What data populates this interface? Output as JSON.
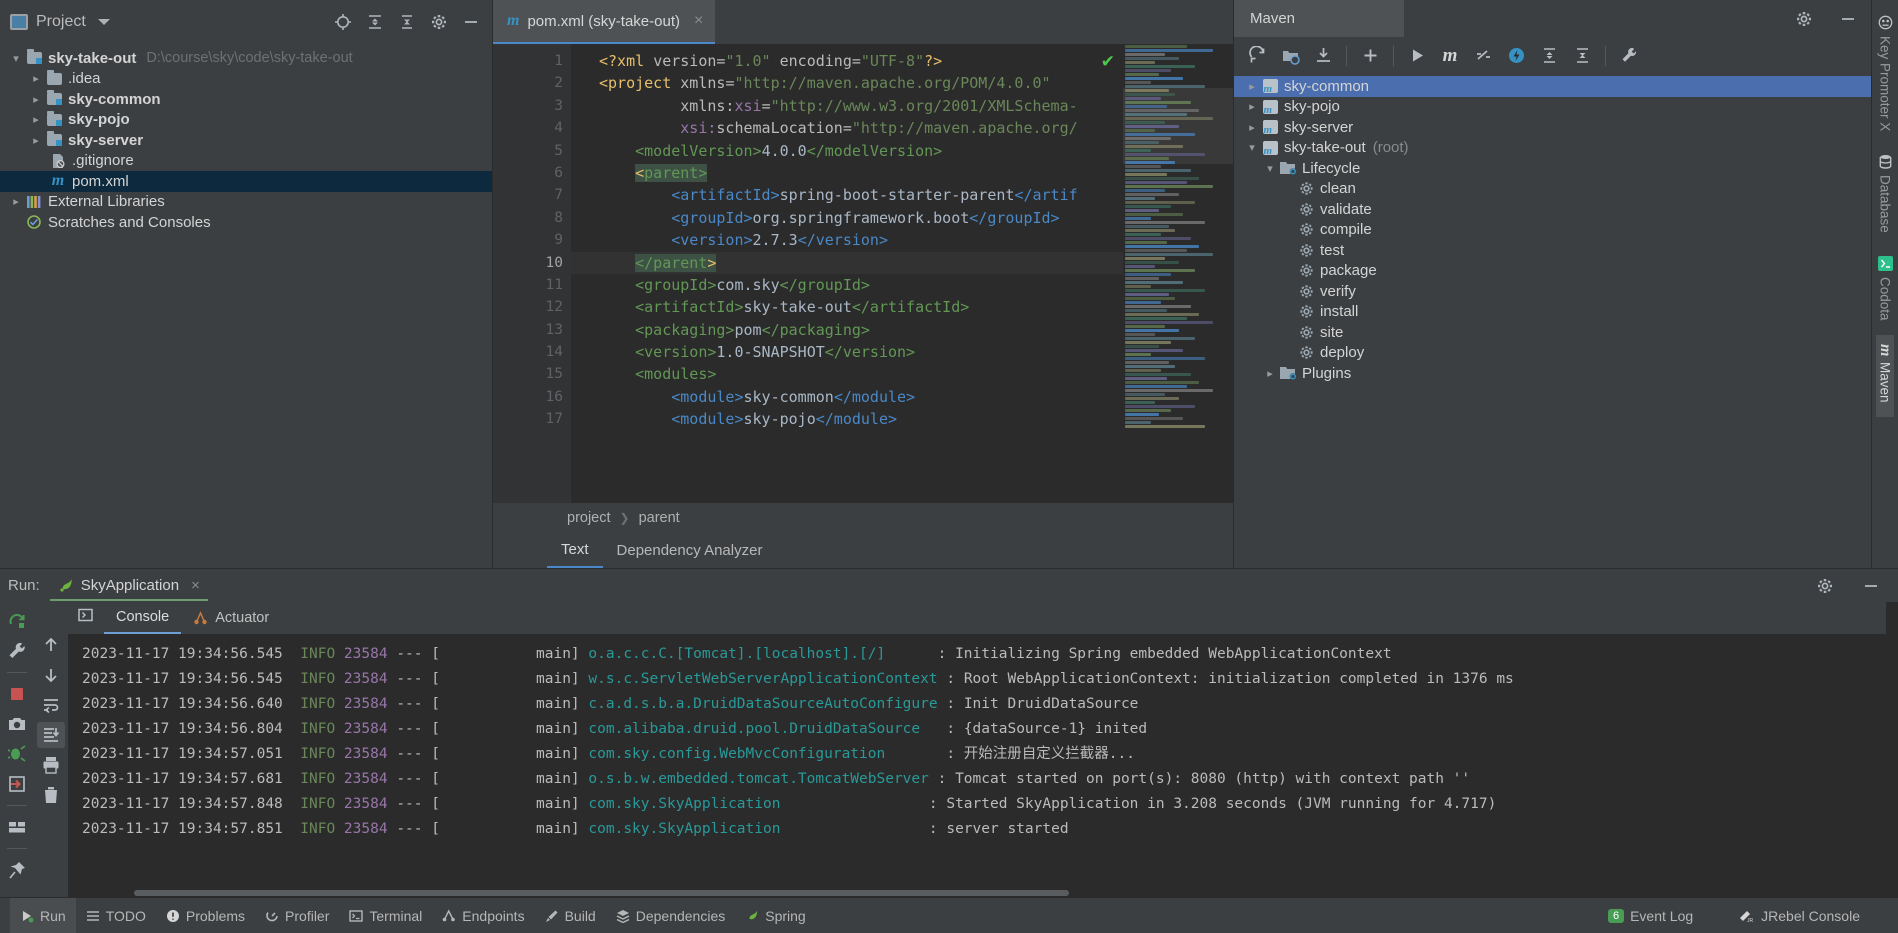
{
  "project_panel": {
    "title": "Project",
    "icons": [
      "locate-icon",
      "expand-all-icon",
      "collapse-all-icon",
      "settings-icon",
      "minimize-icon"
    ],
    "tree": [
      {
        "label": "sky-take-out",
        "sub": "D:\\course\\sky\\code\\sky-take-out",
        "icon": "module-folder-icon",
        "arrow": "down",
        "indent": 0,
        "bold": true,
        "selected": false
      },
      {
        "label": ".idea",
        "sub": "",
        "icon": "folder-icon",
        "arrow": "right",
        "indent": 1,
        "bold": false,
        "selected": false
      },
      {
        "label": "sky-common",
        "sub": "",
        "icon": "module-folder-icon",
        "arrow": "right",
        "indent": 1,
        "bold": true,
        "selected": false
      },
      {
        "label": "sky-pojo",
        "sub": "",
        "icon": "module-folder-icon",
        "arrow": "right",
        "indent": 1,
        "bold": true,
        "selected": false
      },
      {
        "label": "sky-server",
        "sub": "",
        "icon": "module-folder-icon",
        "arrow": "right",
        "indent": 1,
        "bold": true,
        "selected": false
      },
      {
        "label": ".gitignore",
        "sub": "",
        "icon": "gitignore-file-icon",
        "arrow": "none",
        "indent": 2,
        "bold": false,
        "selected": false
      },
      {
        "label": "pom.xml",
        "sub": "",
        "icon": "maven-file-icon",
        "arrow": "none",
        "indent": 2,
        "bold": false,
        "selected": true
      },
      {
        "label": "External Libraries",
        "sub": "",
        "icon": "libraries-icon",
        "arrow": "right",
        "indent": 0,
        "bold": false,
        "selected": false
      },
      {
        "label": "Scratches and Consoles",
        "sub": "",
        "icon": "scratches-icon",
        "arrow": "none",
        "indent": 0,
        "bold": false,
        "selected": false
      }
    ]
  },
  "editor": {
    "tab": {
      "label": "pom.xml (sky-take-out)",
      "icon": "maven-file-icon",
      "close": "×"
    },
    "lines": [
      {
        "n": "1",
        "fold": "",
        "html": "<span class=\"c-tag\">&lt;?xml </span><span class=\"c-attr\">version</span><span class=\"c-attr\">=</span><span class=\"c-val\">\"1.0\"</span><span class=\"c-attr\"> encoding</span><span class=\"c-attr\">=</span><span class=\"c-val\">\"UTF-8\"</span><span class=\"c-tag\">?&gt;</span>"
      },
      {
        "n": "2",
        "fold": "-",
        "html": "<span class=\"c-tag\">&lt;project </span><span class=\"c-attr\">xmlns</span><span class=\"c-attr\">=</span><span class=\"c-val\">\"http://maven.apache.org/POM/4.0.0\"</span>"
      },
      {
        "n": "3",
        "fold": "",
        "html": "         <span class=\"c-attr\">xmlns:</span><span class=\"c-ns\">xsi</span><span class=\"c-attr\">=</span><span class=\"c-val\">\"http://www.w3.org/2001/XMLSchema-</span>"
      },
      {
        "n": "4",
        "fold": "",
        "html": "         <span class=\"c-ns\">xsi:</span><span class=\"c-attr\">schemaLocation</span><span class=\"c-attr\">=</span><span class=\"c-val\">\"http://maven.apache.org/</span>"
      },
      {
        "n": "5",
        "fold": "",
        "html": "    <span class=\"c-name\">&lt;modelVersion&gt;</span><span class=\"c-txt\">4.0.0</span><span class=\"c-name\">&lt;/modelVersion&gt;</span>"
      },
      {
        "n": "6",
        "fold": "-",
        "html": "    <span class=\"sel\"><span class=\"c-tag\">&lt;</span><span class=\"c-name\">parent&gt;</span></span>"
      },
      {
        "n": "7",
        "fold": "",
        "html": "        <span class=\"c-blue\">&lt;artifactId&gt;</span><span class=\"c-txt\">spring-boot-starter-parent</span><span class=\"c-blue\">&lt;/artif</span>"
      },
      {
        "n": "8",
        "fold": "",
        "html": "        <span class=\"c-blue\">&lt;groupId&gt;</span><span class=\"c-txt\">org.springframework.boot</span><span class=\"c-blue\">&lt;/groupId&gt;</span>"
      },
      {
        "n": "9",
        "fold": "",
        "html": "        <span class=\"c-blue\">&lt;version&gt;</span><span class=\"c-txt\">2.7.3</span><span class=\"c-blue\">&lt;/version&gt;</span>"
      },
      {
        "n": "10",
        "fold": "^",
        "html": "    <span class=\"sel\"><span class=\"c-name\">&lt;/parent</span><span class=\"c-tag\">&gt;</span></span>"
      },
      {
        "n": "11",
        "fold": "",
        "html": "    <span class=\"c-name\">&lt;groupId&gt;</span><span class=\"c-txt\">com.sky</span><span class=\"c-name\">&lt;/groupId&gt;</span>"
      },
      {
        "n": "12",
        "fold": "",
        "html": "    <span class=\"c-name\">&lt;artifactId&gt;</span><span class=\"c-txt\">sky-take-out</span><span class=\"c-name\">&lt;/artifactId&gt;</span>"
      },
      {
        "n": "13",
        "fold": "",
        "html": "    <span class=\"c-name\">&lt;packaging&gt;</span><span class=\"c-txt\">pom</span><span class=\"c-name\">&lt;/packaging&gt;</span>"
      },
      {
        "n": "14",
        "fold": "",
        "html": "    <span class=\"c-name\">&lt;version&gt;</span><span class=\"c-txt\">1.0-SNAPSHOT</span><span class=\"c-name\">&lt;/version&gt;</span>"
      },
      {
        "n": "15",
        "fold": "-",
        "html": "    <span class=\"c-name\">&lt;modules&gt;</span>"
      },
      {
        "n": "16",
        "fold": "",
        "html": "        <span class=\"c-blue\">&lt;module&gt;</span><span class=\"c-txt\">sky-common</span><span class=\"c-blue\">&lt;/module&gt;</span>"
      },
      {
        "n": "17",
        "fold": "",
        "html": "        <span class=\"c-blue\">&lt;module&gt;</span><span class=\"c-txt\">sky-pojo</span><span class=\"c-blue\">&lt;/module&gt;</span>"
      }
    ],
    "breadcrumb": [
      "project",
      "parent"
    ],
    "bottom_tabs": [
      {
        "label": "Text",
        "active": true
      },
      {
        "label": "Dependency Analyzer",
        "active": false
      }
    ]
  },
  "maven": {
    "title": "Maven",
    "toolbar_icons": [
      "reload-icon",
      "add-folder-icon",
      "download-sources-icon",
      "plus-icon",
      "run-icon",
      "maven-goal-icon",
      "skip-tests-icon",
      "execute-icon",
      "expand-icon",
      "collapse-icon",
      "settings-wrench-icon"
    ],
    "header_icons": [
      "gear-icon",
      "minimize-icon"
    ],
    "tree": [
      {
        "label": "sky-common",
        "dim": "",
        "arrow": "right",
        "indent": 0,
        "icon": "maven-module-icon",
        "selected": true
      },
      {
        "label": "sky-pojo",
        "dim": "",
        "arrow": "right",
        "indent": 0,
        "icon": "maven-module-icon",
        "selected": false
      },
      {
        "label": "sky-server",
        "dim": "",
        "arrow": "right",
        "indent": 0,
        "icon": "maven-module-icon",
        "selected": false
      },
      {
        "label": "sky-take-out",
        "dim": "(root)",
        "arrow": "down",
        "indent": 0,
        "icon": "maven-module-icon",
        "selected": false
      },
      {
        "label": "Lifecycle",
        "dim": "",
        "arrow": "down",
        "indent": 1,
        "icon": "lifecycle-folder-icon",
        "selected": false
      },
      {
        "label": "clean",
        "dim": "",
        "arrow": "none",
        "indent": 2,
        "icon": "goal-icon",
        "selected": false
      },
      {
        "label": "validate",
        "dim": "",
        "arrow": "none",
        "indent": 2,
        "icon": "goal-icon",
        "selected": false
      },
      {
        "label": "compile",
        "dim": "",
        "arrow": "none",
        "indent": 2,
        "icon": "goal-icon",
        "selected": false
      },
      {
        "label": "test",
        "dim": "",
        "arrow": "none",
        "indent": 2,
        "icon": "goal-icon",
        "selected": false
      },
      {
        "label": "package",
        "dim": "",
        "arrow": "none",
        "indent": 2,
        "icon": "goal-icon",
        "selected": false
      },
      {
        "label": "verify",
        "dim": "",
        "arrow": "none",
        "indent": 2,
        "icon": "goal-icon",
        "selected": false
      },
      {
        "label": "install",
        "dim": "",
        "arrow": "none",
        "indent": 2,
        "icon": "goal-icon",
        "selected": false
      },
      {
        "label": "site",
        "dim": "",
        "arrow": "none",
        "indent": 2,
        "icon": "goal-icon",
        "selected": false
      },
      {
        "label": "deploy",
        "dim": "",
        "arrow": "none",
        "indent": 2,
        "icon": "goal-icon",
        "selected": false
      },
      {
        "label": "Plugins",
        "dim": "",
        "arrow": "right",
        "indent": 1,
        "icon": "plugins-folder-icon",
        "selected": false
      }
    ]
  },
  "right_tool_tabs": [
    {
      "label": "Key Promoter X",
      "icon": "key-promoter-icon",
      "active": false
    },
    {
      "label": "Database",
      "icon": "database-icon",
      "active": false
    },
    {
      "label": "Codota",
      "icon": "codota-icon",
      "active": false
    },
    {
      "label": "Maven",
      "icon": "maven-icon",
      "active": true
    }
  ],
  "run_panel": {
    "label": "Run:",
    "config_name": "SkyApplication",
    "config_icon": "spring-leaf-icon",
    "close": "×",
    "header_icons": [
      "settings-icon",
      "minimize-icon"
    ],
    "left_tools": [
      "rerun-icon",
      "wrench-icon",
      "stop-icon",
      "camera-icon",
      "debug-icon",
      "exit-icon",
      "layout-icon",
      "pin-icon"
    ],
    "second_tools": [
      "expand-console-icon",
      "up-icon",
      "down-icon",
      "soft-wrap-icon",
      "scroll-to-end-icon",
      "print-icon",
      "trash-icon"
    ],
    "tabs": [
      {
        "label": "Console",
        "icon": "console-icon",
        "active": true
      },
      {
        "label": "Actuator",
        "icon": "actuator-icon",
        "active": false
      }
    ],
    "log": [
      {
        "ts": "2023-11-17 19:34:56.545",
        "lvl": "INFO",
        "pid": "23584",
        "thread": "main]",
        "logger": "o.a.c.c.C.[Tomcat].[localhost].[/]",
        "msg": "Initializing Spring embedded WebApplicationContext"
      },
      {
        "ts": "2023-11-17 19:34:56.545",
        "lvl": "INFO",
        "pid": "23584",
        "thread": "main]",
        "logger": "w.s.c.ServletWebServerApplicationContext",
        "msg": "Root WebApplicationContext: initialization completed in 1376 ms"
      },
      {
        "ts": "2023-11-17 19:34:56.640",
        "lvl": "INFO",
        "pid": "23584",
        "thread": "main]",
        "logger": "c.a.d.s.b.a.DruidDataSourceAutoConfigure",
        "msg": "Init DruidDataSource"
      },
      {
        "ts": "2023-11-17 19:34:56.804",
        "lvl": "INFO",
        "pid": "23584",
        "thread": "main]",
        "logger": "com.alibaba.druid.pool.DruidDataSource",
        "msg": "{dataSource-1} inited"
      },
      {
        "ts": "2023-11-17 19:34:57.051",
        "lvl": "INFO",
        "pid": "23584",
        "thread": "main]",
        "logger": "com.sky.config.WebMvcConfiguration",
        "msg": "开始注册自定义拦截器..."
      },
      {
        "ts": "2023-11-17 19:34:57.681",
        "lvl": "INFO",
        "pid": "23584",
        "thread": "main]",
        "logger": "o.s.b.w.embedded.tomcat.TomcatWebServer",
        "msg": "Tomcat started on port(s): 8080 (http) with context path ''"
      },
      {
        "ts": "2023-11-17 19:34:57.848",
        "lvl": "INFO",
        "pid": "23584",
        "thread": "main]",
        "logger": "com.sky.SkyApplication",
        "msg": "Started SkyApplication in 3.208 seconds (JVM running for 4.717)"
      },
      {
        "ts": "2023-11-17 19:34:57.851",
        "lvl": "INFO",
        "pid": "23584",
        "thread": "main]",
        "logger": "com.sky.SkyApplication",
        "msg": "server started"
      }
    ]
  },
  "status_bar": {
    "left": [
      {
        "label": "Run",
        "icon": "run-icon",
        "active": true
      },
      {
        "label": "TODO",
        "icon": "todo-icon",
        "active": false
      },
      {
        "label": "Problems",
        "icon": "problems-icon",
        "active": false
      },
      {
        "label": "Profiler",
        "icon": "profiler-icon",
        "active": false
      },
      {
        "label": "Terminal",
        "icon": "terminal-icon",
        "active": false
      },
      {
        "label": "Endpoints",
        "icon": "endpoints-icon",
        "active": false
      },
      {
        "label": "Build",
        "icon": "build-icon",
        "active": false
      },
      {
        "label": "Dependencies",
        "icon": "dependencies-icon",
        "active": false
      },
      {
        "label": "Spring",
        "icon": "spring-icon",
        "active": false
      }
    ],
    "right": [
      {
        "label": "Event Log",
        "icon": "event-log-icon",
        "count": "6"
      },
      {
        "label": "JRebel Console",
        "icon": "jrebel-icon",
        "count": ""
      }
    ]
  },
  "colors": {
    "accent": "#4b6eaf",
    "selection": "#0d293e",
    "editor_bg": "#2b2b2b",
    "panel_bg": "#3c3f41",
    "info_green": "#6a8759",
    "logger_teal": "#299999"
  }
}
